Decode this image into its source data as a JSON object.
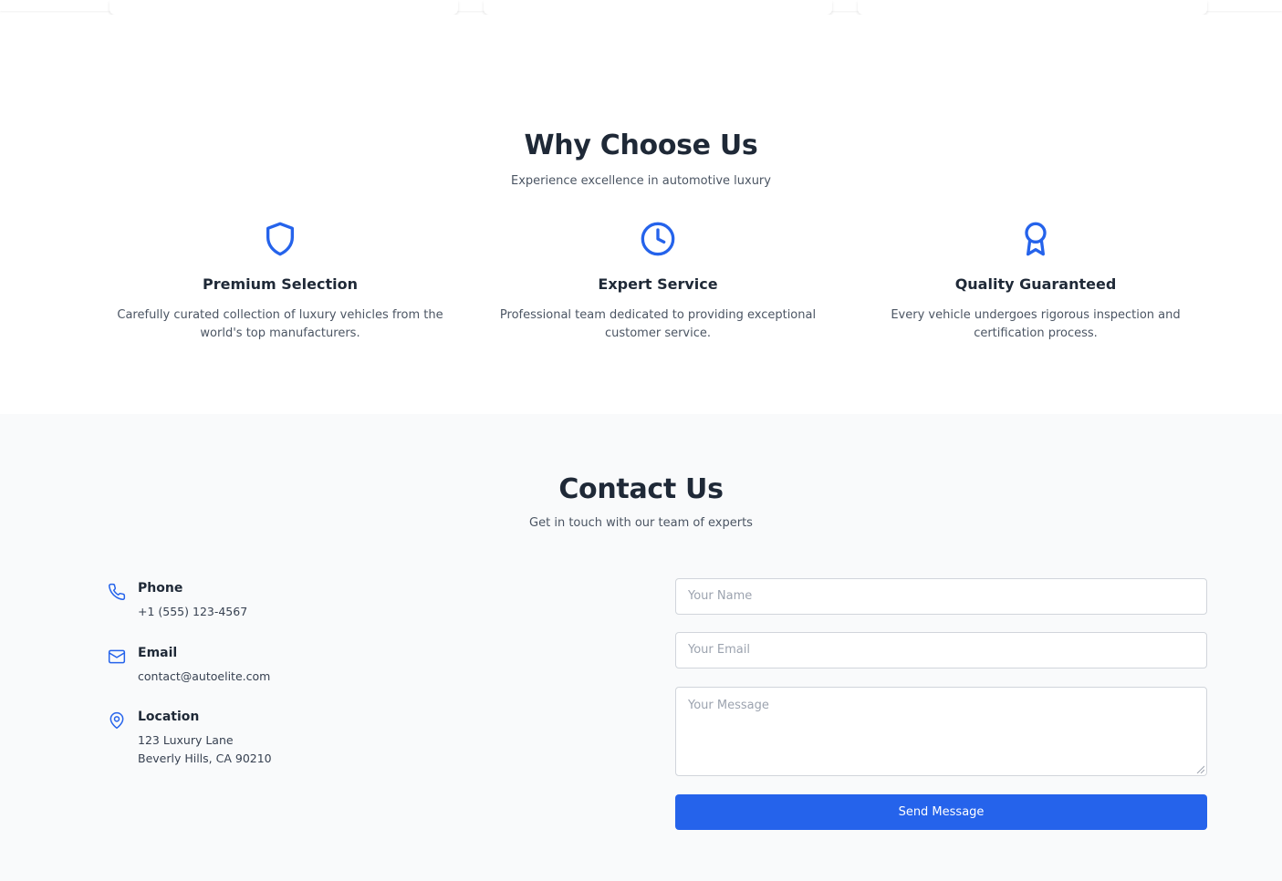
{
  "why_choose": {
    "title": "Why Choose Us",
    "subtitle": "Experience excellence in automotive luxury",
    "features": [
      {
        "icon": "shield-icon",
        "title": "Premium Selection",
        "description": "Carefully curated collection of luxury vehicles from the world's top manufacturers."
      },
      {
        "icon": "clock-icon",
        "title": "Expert Service",
        "description": "Professional team dedicated to providing exceptional customer service."
      },
      {
        "icon": "award-icon",
        "title": "Quality Guaranteed",
        "description": "Every vehicle undergoes rigorous inspection and certification process."
      }
    ]
  },
  "contact": {
    "title": "Contact Us",
    "subtitle": "Get in touch with our team of experts",
    "info": [
      {
        "icon": "phone-icon",
        "label": "Phone",
        "value": "+1 (555) 123-4567"
      },
      {
        "icon": "mail-icon",
        "label": "Email",
        "value": "contact@autoelite.com"
      },
      {
        "icon": "map-pin-icon",
        "label": "Location",
        "lines": [
          "123 Luxury Lane",
          "Beverly Hills, CA 90210"
        ]
      }
    ],
    "form": {
      "name_placeholder": "Your Name",
      "email_placeholder": "Your Email",
      "message_placeholder": "Your Message",
      "submit_label": "Send Message"
    }
  },
  "colors": {
    "accent": "#2563eb",
    "heading": "#1f2937",
    "body_text": "#4b5563",
    "contact_background": "#f9fafb"
  }
}
